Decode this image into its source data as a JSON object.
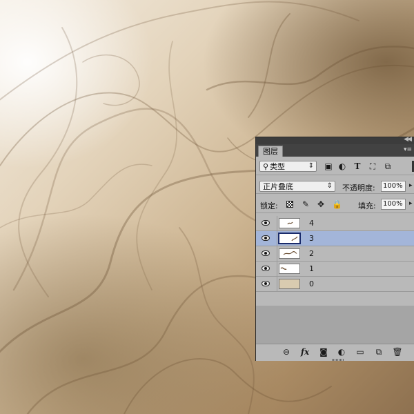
{
  "colors": {
    "panel_dark": "#535353",
    "panel_light": "#b9b9b9",
    "selection": "#a3b5d9",
    "smoke_brown": "#7a5c3c"
  },
  "panel": {
    "tab_label": "图层",
    "collapse_icon": "double-arrow-icon",
    "menu_icon": "panel-menu-icon"
  },
  "filter": {
    "kind_label": "类型",
    "icons": [
      "image-filter-icon",
      "adjustment-filter-icon",
      "text-filter-icon",
      "shape-filter-icon",
      "smart-object-filter-icon"
    ]
  },
  "blend": {
    "mode": "正片叠底",
    "opacity_label": "不透明度:",
    "opacity_value": "100%"
  },
  "lock": {
    "label": "锁定:",
    "icons": [
      "lock-pixels-icon",
      "lock-brush-icon",
      "lock-position-icon",
      "lock-all-icon"
    ],
    "fill_label": "填充:",
    "fill_value": "100%"
  },
  "layers": [
    {
      "name": "4",
      "visible": true,
      "selected": false
    },
    {
      "name": "3",
      "visible": true,
      "selected": true
    },
    {
      "name": "2",
      "visible": true,
      "selected": false
    },
    {
      "name": "1",
      "visible": true,
      "selected": false
    },
    {
      "name": "0",
      "visible": true,
      "selected": false
    }
  ],
  "bottom_toolbar": [
    "link-layers-icon",
    "fx-icon",
    "add-mask-icon",
    "adjustment-layer-icon",
    "new-group-icon",
    "new-layer-icon",
    "trash-icon"
  ]
}
